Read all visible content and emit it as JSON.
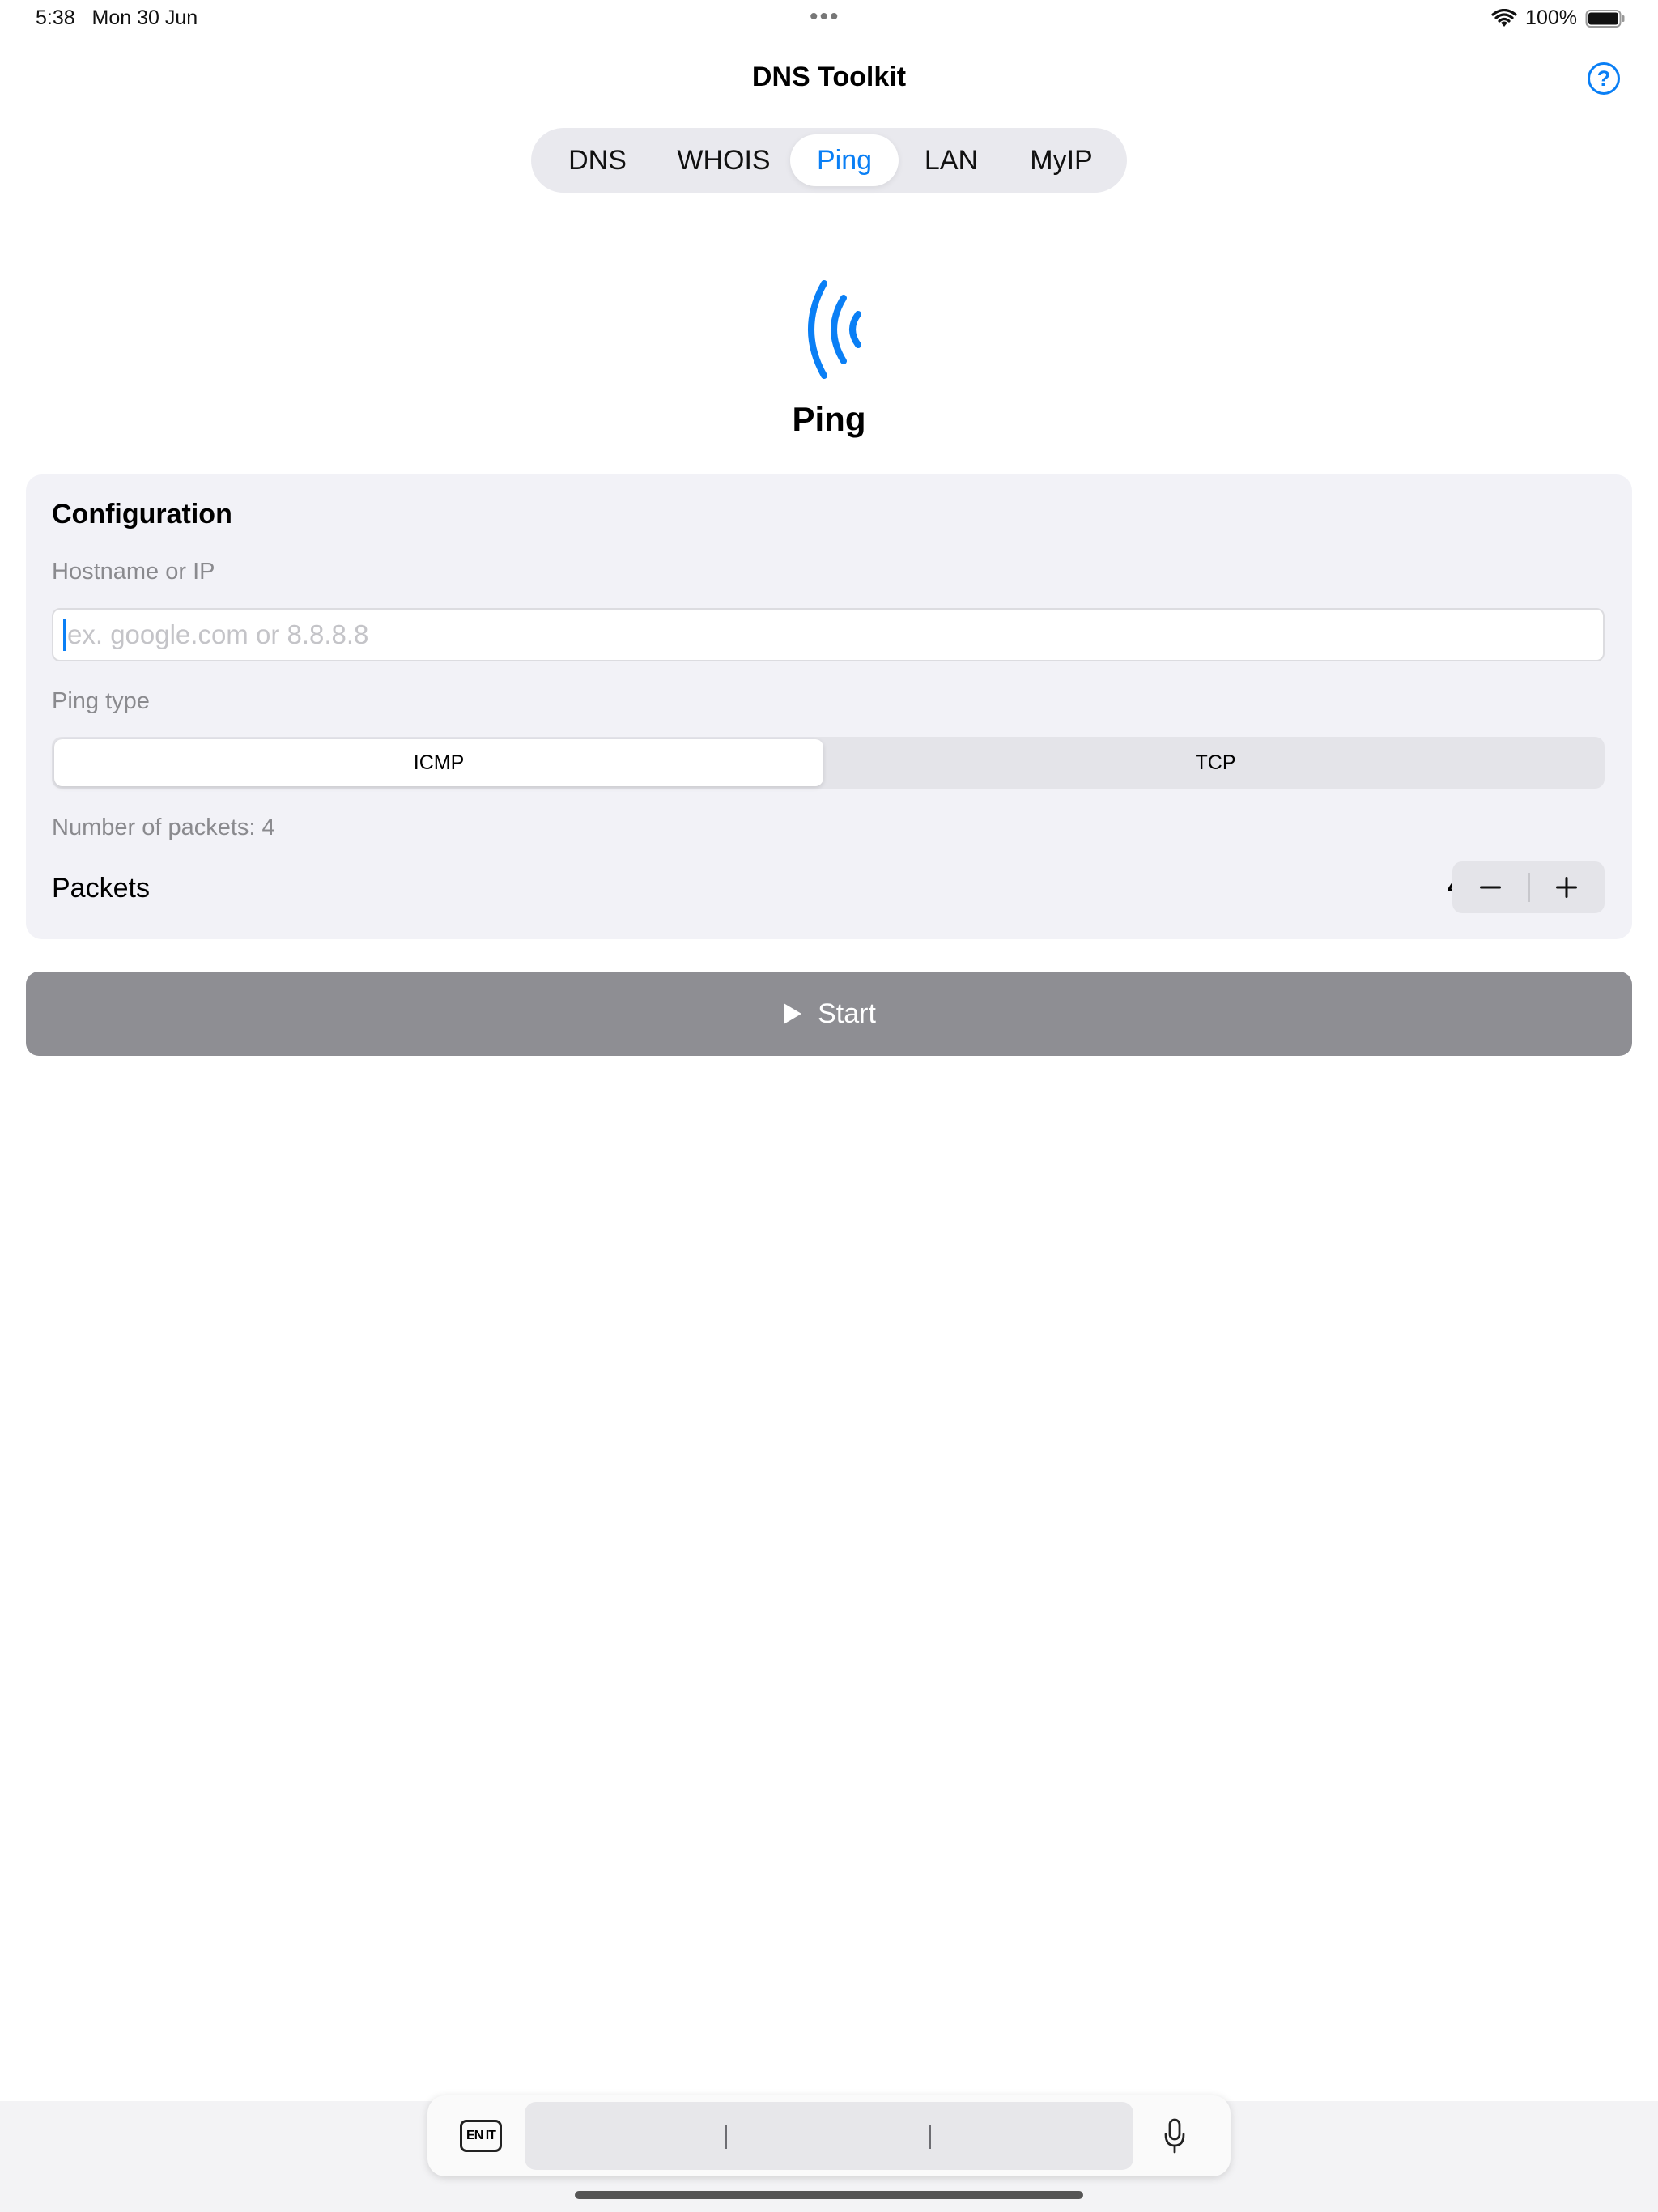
{
  "status_bar": {
    "time": "5:38",
    "date": "Mon 30 Jun",
    "battery": "100%"
  },
  "nav": {
    "title": "DNS Toolkit",
    "help_symbol": "?"
  },
  "tabs": [
    {
      "label": "DNS",
      "active": false
    },
    {
      "label": "WHOIS",
      "active": false
    },
    {
      "label": "Ping",
      "active": true
    },
    {
      "label": "LAN",
      "active": false
    },
    {
      "label": "MyIP",
      "active": false
    }
  ],
  "header": {
    "title": "Ping",
    "icon": "ping-waves-icon"
  },
  "config": {
    "title": "Configuration",
    "hostname_label": "Hostname or IP",
    "hostname_value": "",
    "hostname_placeholder": "ex. google.com or 8.8.8.8",
    "ping_type_label": "Ping type",
    "ping_types": [
      "ICMP",
      "TCP"
    ],
    "selected_ping_type": "ICMP",
    "packet_summary": "Number of packets: 4",
    "packets_label": "Packets",
    "packets_value": "4"
  },
  "start_button": {
    "label": "Start"
  },
  "keyboard_bar": {
    "globe_label": "EN IT"
  },
  "colors": {
    "accent": "#0a7ff5",
    "card_bg": "#f2f2f7",
    "start_disabled": "#8e8e93"
  }
}
